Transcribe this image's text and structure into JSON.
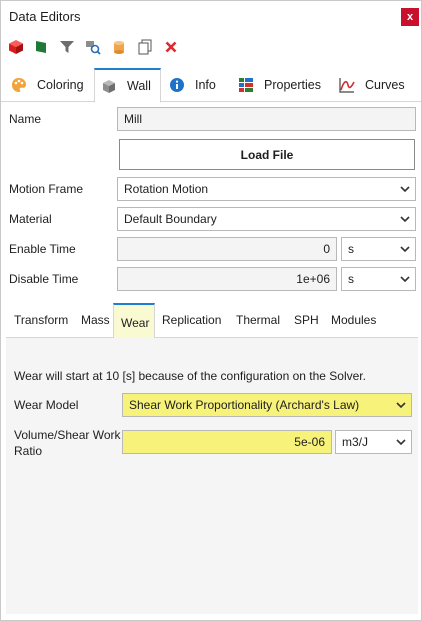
{
  "window": {
    "title": "Data Editors",
    "close_glyph": "x"
  },
  "toolbar": {
    "icons": [
      "cube-icon",
      "flag-icon",
      "filter-icon",
      "search-icon",
      "cylinder-icon",
      "copy-icon",
      "delete-icon"
    ]
  },
  "main_tabs": [
    {
      "label": "Coloring",
      "icon": "palette-icon"
    },
    {
      "label": "Wall",
      "icon": "wall-icon"
    },
    {
      "label": "Info",
      "icon": "info-icon"
    },
    {
      "label": "Properties",
      "icon": "properties-icon"
    },
    {
      "label": "Curves",
      "icon": "curve-icon"
    }
  ],
  "active_main_tab": "Wall",
  "form": {
    "name_label": "Name",
    "name_value": "Mill",
    "load_file_label": "Load File",
    "motion_frame_label": "Motion Frame",
    "motion_frame_value": "Rotation Motion",
    "material_label": "Material",
    "material_value": "Default Boundary",
    "enable_time_label": "Enable Time",
    "enable_time_value": "0",
    "enable_time_unit": "s",
    "disable_time_label": "Disable Time",
    "disable_time_value": "1e+06",
    "disable_time_unit": "s"
  },
  "sub_tabs": [
    "Transform",
    "Mass",
    "Wear",
    "Replication",
    "Thermal",
    "SPH",
    "Modules"
  ],
  "active_sub_tab": "Wear",
  "wear": {
    "note": "Wear will start at 10 [s] because of the configuration on the Solver.",
    "wear_model_label": "Wear Model",
    "wear_model_value": "Shear Work Proportionality (Archard's Law)",
    "ratio_label_line1": "Volume/Shear Work",
    "ratio_label_line2": "Ratio",
    "ratio_value": "5e-06",
    "ratio_unit": "m3/J"
  },
  "colors": {
    "accent": "#1e7fd0",
    "highlight": "#f7f27a",
    "close": "#c8102e"
  }
}
